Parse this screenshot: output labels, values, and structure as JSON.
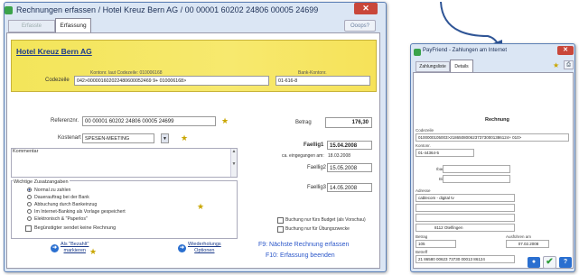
{
  "main_window": {
    "title": "Rechnungen erfassen  /  Hotel Kreuz Bern AG / 00 00001 60202 24806 00005 24699",
    "tabs": [
      "Erfasste Rechnungen",
      "Erfassung"
    ],
    "oops_label": "Ooops?",
    "header": {
      "hotel": "Hotel Kreuz Bern AG",
      "konto_label": "Kontonr. laut Codezeile: 010006168",
      "bank_label": "Bank-Kontonr.",
      "codezeile_label": "Codezeile",
      "codezeile_value": "042>000001602022480600052469 9+ 010006168>",
      "bank_value": "01-616-8"
    },
    "referenz_label": "Referenznr.",
    "referenz_value": "00 00001 60202 24806 00005 24699",
    "kostenart_label": "Kostenart",
    "kostenart_value": "SPESEN-MEETING",
    "betrag_label": "Betrag",
    "betrag_value": "176,30",
    "kommentar_label": "Kommentar",
    "faellig1_label": "Faellig1",
    "faellig1_value": "15.04.2008",
    "eingang_label": "ca. eingegangen am:",
    "eingang_value": "18.03.2008",
    "faellig2_label": "Faellig2",
    "faellig2_value": "15.05.2008",
    "faellig3_label": "Faellig3",
    "faellig3_value": "14.05.2008",
    "zusatz_label": "Wichtige Zusatzangaben",
    "radio_options": [
      "Normal zu zahlen",
      "Dauerauftrag bei der Bank",
      "Abbuchung durch Bankeinzug",
      "Im Internet-Banking als Vorlage gespeichert",
      "Elektronisch & \"Paperlos\""
    ],
    "no_bill_label": "Begünstigter sendet keine Rechnung",
    "budget_label": "Buchung nur fürs Budget (als Vorschau)",
    "uebung_label": "Buchung nur für Übungszwecke",
    "bezahlt_line1": "Als \"Bezahlt\"",
    "bezahlt_line2": "markieren",
    "wied_line1": "Wiederholungs",
    "wied_line2": "Optionen",
    "f9_label": "F9:  Nächste Rechnung erfassen",
    "f10_label": "F10: Erfassung beenden"
  },
  "right_window": {
    "title": "PayFriend - Zahlungen am Internet",
    "tabs": [
      "Zahlungsliste",
      "Details"
    ],
    "heading": "Rechnung",
    "codezeile_label": "Codezeile",
    "codezeile_value": "0100000105003>21865080062373730001386124+ 010>",
    "konto_label": "Kontonr.",
    "konto_value": "01-44364-5",
    "iban_label": "Iban",
    "bic_label": "Bic",
    "adresse_label": "Adresse",
    "adresse_lines": [
      "cablecom - digital tv",
      "",
      ""
    ],
    "adresse_city": "8112 Otelfingen",
    "betrag_label": "Betrag",
    "betrag_value": "105",
    "ausfuehren_label": "Ausführen am",
    "ausfuehren_value": "07.02.2008",
    "betreff_label": "Betreff",
    "betreff_value": "21 86580 00623 73730 00013 86124"
  },
  "colors": {
    "accent_blue": "#2a6fd0",
    "header_yellow": "#f3e55a",
    "close_red": "#c9473a"
  }
}
